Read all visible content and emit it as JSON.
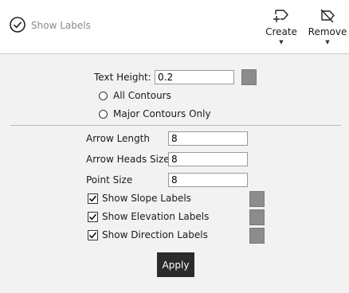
{
  "toolbar": {
    "show_labels": {
      "label": "Show Labels",
      "icon": "check-circle-icon"
    },
    "create": {
      "label": "Create",
      "icon": "tag-plus-icon"
    },
    "remove": {
      "label": "Remove",
      "icon": "tag-slash-icon"
    }
  },
  "contours": {
    "text_height_label": "Text Height:",
    "text_height_value": "0.2",
    "swatch_color": "#8c8c8c",
    "options": [
      "All Contours",
      "Major Contours Only"
    ]
  },
  "arrows": {
    "arrow_length_label": "Arrow Length",
    "arrow_length_value": "8",
    "arrow_heads_label": "Arrow Heads Size",
    "arrow_heads_value": "8",
    "point_size_label": "Point Size",
    "point_size_value": "8"
  },
  "labels": {
    "slope": {
      "label": "Show Slope Labels",
      "checked": true
    },
    "elevation": {
      "label": "Show Elevation Labels",
      "checked": true
    },
    "direction": {
      "label": "Show Direction Labels",
      "checked": true
    }
  },
  "apply_label": "Apply"
}
